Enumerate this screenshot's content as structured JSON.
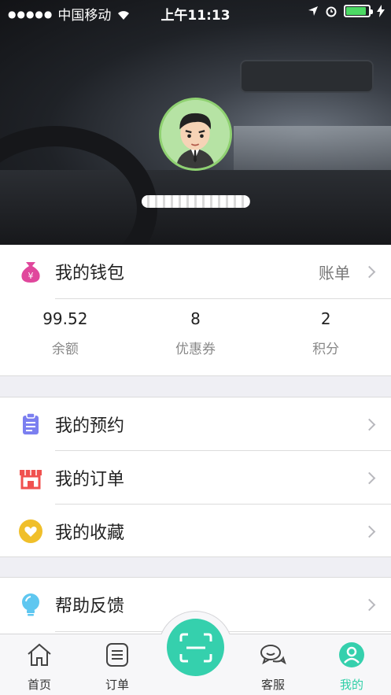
{
  "status_bar": {
    "carrier": "中国移动",
    "time": "上午11:13",
    "battery_level": 0.9
  },
  "profile": {
    "username": ""
  },
  "wallet": {
    "title": "我的钱包",
    "bill_label": "账单",
    "stats": [
      {
        "value": "99.52",
        "label": "余额"
      },
      {
        "value": "8",
        "label": "优惠券"
      },
      {
        "value": "2",
        "label": "积分"
      }
    ]
  },
  "menu": [
    {
      "label": "我的预约",
      "icon": "clipboard-icon"
    },
    {
      "label": "我的订单",
      "icon": "store-icon"
    },
    {
      "label": "我的收藏",
      "icon": "heart-icon"
    },
    {
      "label": "帮助反馈",
      "icon": "lightbulb-icon"
    }
  ],
  "tabbar": {
    "tabs": [
      {
        "label": "首页",
        "icon": "home-icon"
      },
      {
        "label": "订单",
        "icon": "order-list-icon"
      },
      {
        "label": "客服",
        "icon": "chat-icon"
      },
      {
        "label": "我的",
        "icon": "profile-icon"
      }
    ],
    "active_tab": "我的",
    "scan_icon": "scan-icon",
    "accent_color": "#35d0ad"
  }
}
